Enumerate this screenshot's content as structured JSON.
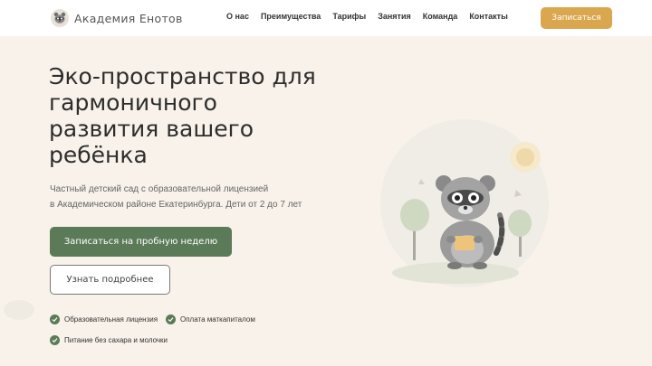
{
  "header": {
    "brand": "Академия Енотов",
    "nav": [
      {
        "label": "О нас"
      },
      {
        "label": "Преимущества"
      },
      {
        "label": "Тарифы"
      },
      {
        "label": "Занятия"
      },
      {
        "label": "Команда"
      },
      {
        "label": "Контакты"
      }
    ],
    "cta_label": "Записаться"
  },
  "hero": {
    "title_lines": [
      "Эко-пространство для",
      "гармоничного",
      "развития вашего",
      "ребёнка"
    ],
    "subtitle_lines": [
      "Частный детский сад с образовательной лицензией",
      "в Академическом районе Екатеринбурга. Дети от 2 до 7 лет"
    ],
    "primary_button": "Записаться на пробную неделю",
    "secondary_button": "Узнать подробнее"
  },
  "features": [
    {
      "label": "Образовательная лицензия"
    },
    {
      "label": "Оплата маткапиталом"
    },
    {
      "label": "Питание без сахара и молочки"
    }
  ],
  "colors": {
    "background": "#f8f2ea",
    "primary_green": "#5b7a57",
    "accent_gold": "#dba74e"
  },
  "icons": {
    "logo": "raccoon-logo-icon",
    "check": "check-icon",
    "illustration": "raccoon-illustration"
  }
}
